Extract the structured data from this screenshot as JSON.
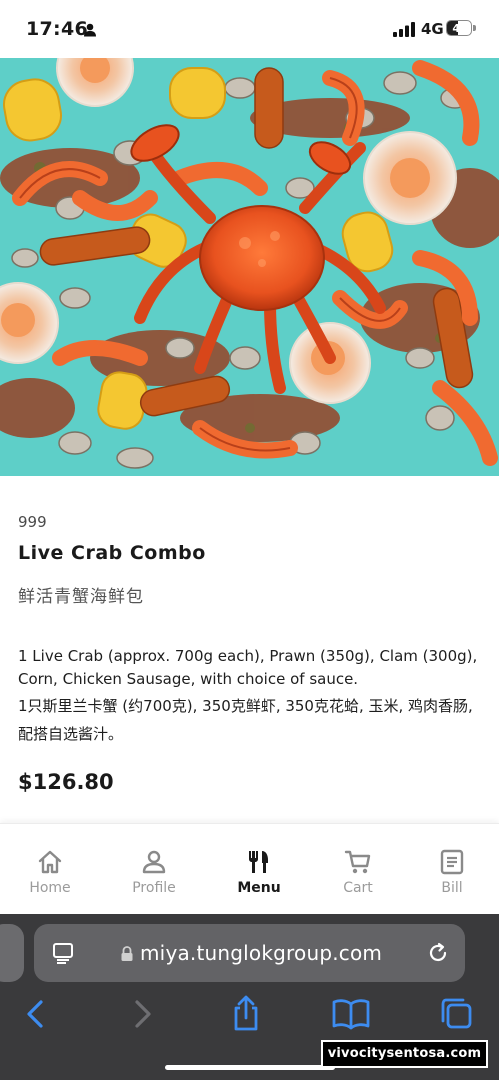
{
  "status_bar": {
    "time": "17:46",
    "network": "4G",
    "battery": "45",
    "battery_level": 0.45
  },
  "hero_image": {
    "description_icon": "seafood-photo"
  },
  "product": {
    "code": "999",
    "name": "Live Crab Combo",
    "name_cn": "鲜活青蟹海鲜包",
    "description": "1 Live Crab (approx. 700g each), Prawn (350g), Clam (300g), Corn, Chicken Sausage, with choice of sauce.",
    "description_cn": "1只斯里兰卡蟹 (约700克), 350克鲜虾, 350克花蛤, 玉米, 鸡肉香肠, 配搭自选酱汁。",
    "price": "$126.80"
  },
  "bottom_nav": {
    "items": [
      {
        "label": "Home",
        "icon": "home-icon"
      },
      {
        "label": "Profile",
        "icon": "profile-icon"
      },
      {
        "label": "Menu",
        "icon": "utensils-icon",
        "active": true
      },
      {
        "label": "Cart",
        "icon": "cart-icon"
      },
      {
        "label": "Bill",
        "icon": "bill-icon"
      }
    ]
  },
  "browser": {
    "url": "miya.tunglokgroup.com"
  },
  "watermark": "vivocitysentosa.com",
  "colors": {
    "accent_text": "#1a1a1a",
    "inactive_nav": "#9b9b9b",
    "browser_blue": "#3d8cf0",
    "hero_background": "#5ecfc8",
    "crab_orange": "#e8521f"
  }
}
